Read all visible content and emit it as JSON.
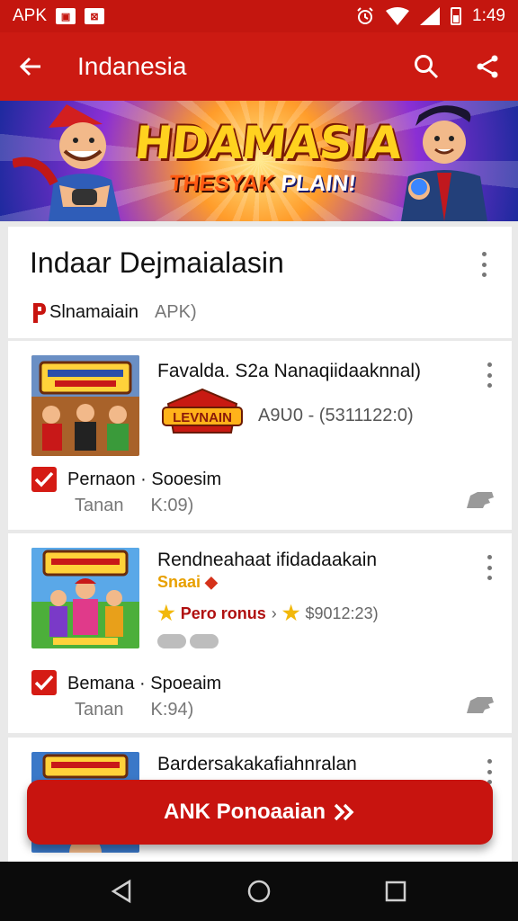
{
  "status_bar": {
    "left_text": "APK",
    "time": "1:49"
  },
  "app_bar": {
    "title": "Indanesia"
  },
  "banner": {
    "title": "HDAMASIA",
    "subtitle_prefix": "THESYAK",
    "subtitle_suffix": "PLAIN!"
  },
  "header": {
    "title": "Indaar Dejmaialasin",
    "publisher": "Slnamaiain",
    "tag": "APK)"
  },
  "items": [
    {
      "title": "Favalda. S2a Nanaqiidaaknnal)",
      "badge_text": "LEVNAIN",
      "rating_text": "A9Ʋ0 - (5311122:0)",
      "line1": "Pernaon · Sooesim",
      "line2a": "Tanan",
      "line2b": "K:09)"
    },
    {
      "title": "Rendneahaat ifidadaakain",
      "small_badge": "Snaai",
      "stars_text": "Pero ronus",
      "stars_extra": "$9012:23)",
      "line1": "Bemana · Spoeaim",
      "line2a": "Tanan",
      "line2b": "K:94)"
    },
    {
      "title": "Bardersakakafiahnralan"
    }
  ],
  "cta": {
    "label": "ANK Ponoaaian"
  },
  "colors": {
    "brand_red": "#cc1a12",
    "status_red": "#c4160f",
    "cta_red": "#c8140f"
  }
}
